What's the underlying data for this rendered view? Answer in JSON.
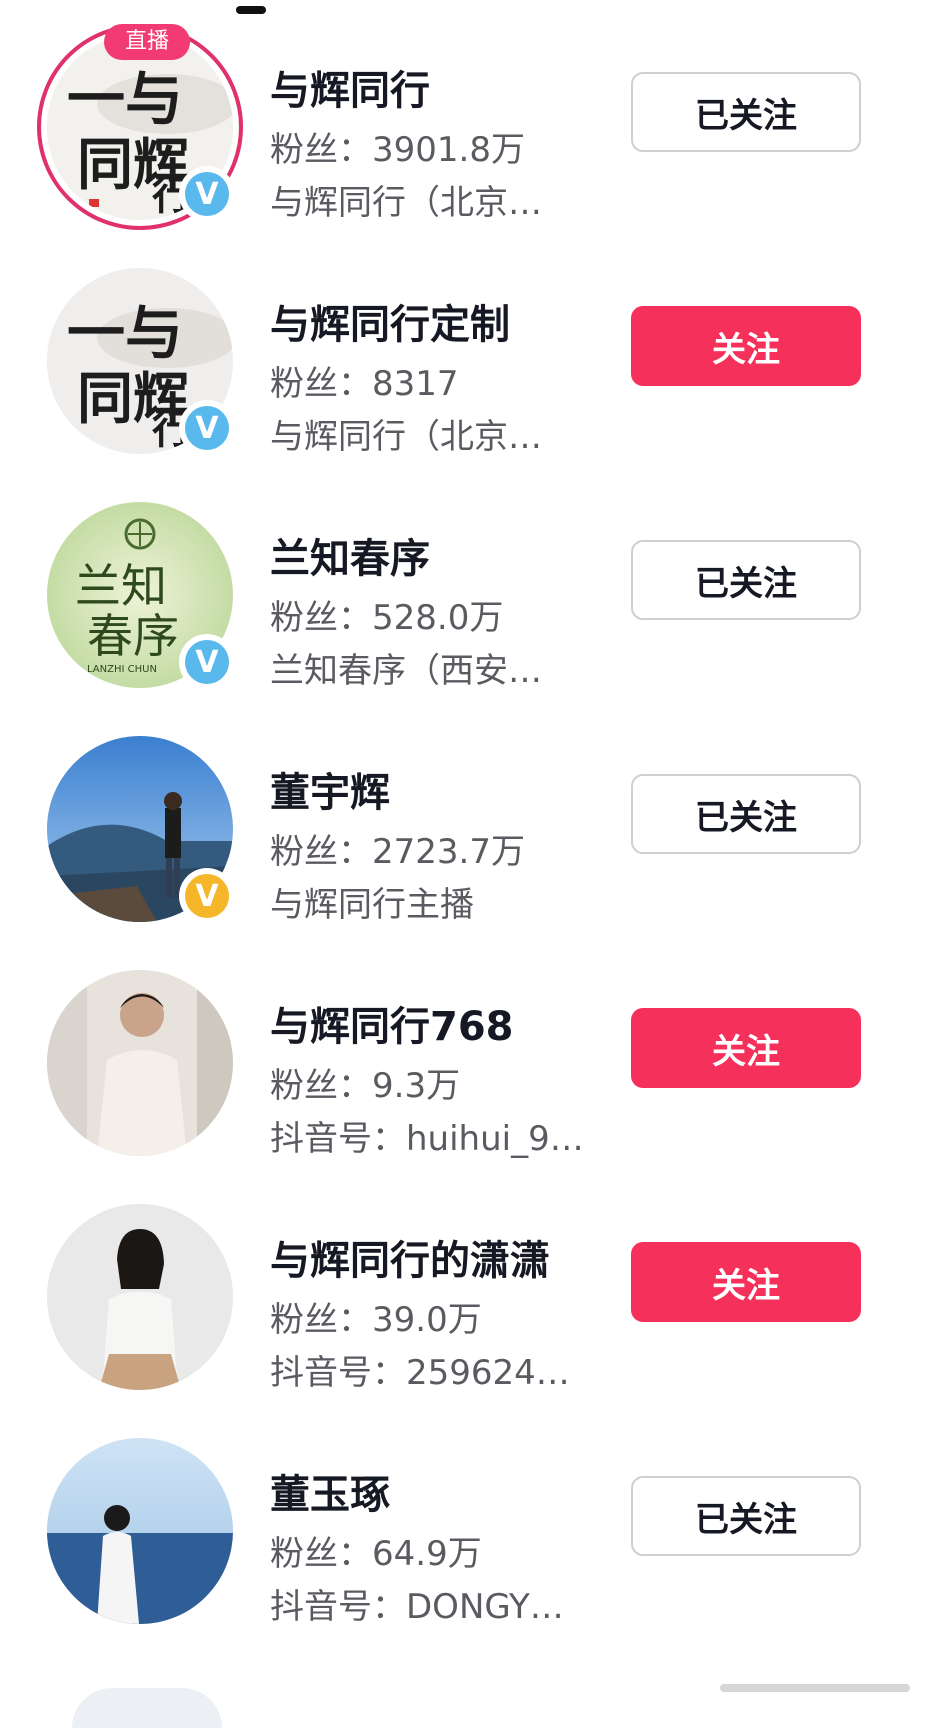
{
  "accounts": [
    {
      "name": "与辉同行",
      "fans": "粉丝：3901.8万",
      "sub": "与辉同行（北京…",
      "button": "已关注",
      "live_badge": "直播",
      "verify_mark": "V",
      "verify_color": "#59b8ec"
    },
    {
      "name": "与辉同行定制",
      "fans": "粉丝：8317",
      "sub": "与辉同行（北京…",
      "button": "关注",
      "verify_mark": "V",
      "verify_color": "#59b8ec"
    },
    {
      "name": "兰知春序",
      "fans": "粉丝：528.0万",
      "sub": "兰知春序（西安…",
      "button": "已关注",
      "verify_mark": "V",
      "verify_color": "#59b8ec"
    },
    {
      "name": "董宇辉",
      "fans": "粉丝：2723.7万",
      "sub": "与辉同行主播",
      "button": "已关注",
      "verify_mark": "V",
      "verify_color": "#f5b629"
    },
    {
      "name": "与辉同行768",
      "fans": "粉丝：9.3万",
      "sub": "抖音号：huihui_9…",
      "button": "关注"
    },
    {
      "name": "与辉同行的潇潇",
      "fans": "粉丝：39.0万",
      "sub": "抖音号：259624…",
      "button": "关注"
    },
    {
      "name": "董玉琢",
      "fans": "粉丝：64.9万",
      "sub": "抖音号：DONGY…",
      "button": "已关注"
    }
  ],
  "avatar_art": {
    "calligraphy": [
      "一与",
      "同辉",
      "行"
    ],
    "lanzhi": {
      "line1": "兰知",
      "line2": "春序",
      "caption": "LANZHI CHUN"
    }
  },
  "colors": {
    "follow_button": "#f5305a",
    "live_ring": "#e0316a",
    "verify_blue": "#59b8ec",
    "verify_gold": "#f5b629"
  }
}
